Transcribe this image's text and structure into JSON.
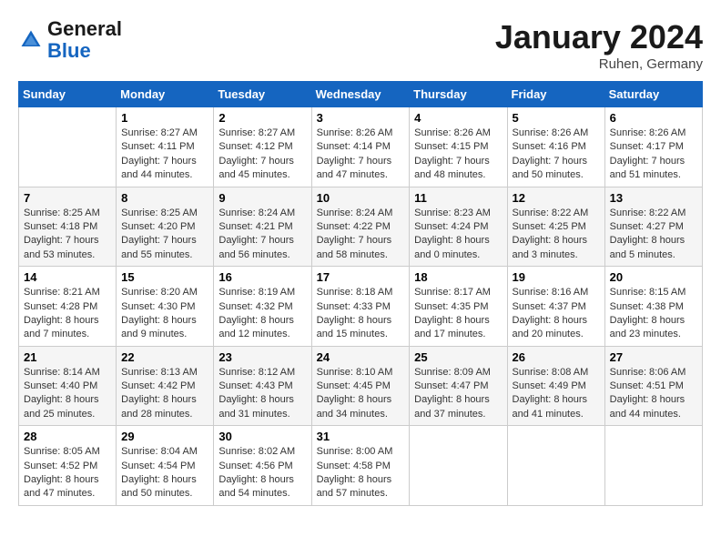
{
  "header": {
    "logo_line1": "General",
    "logo_line2": "Blue",
    "month": "January 2024",
    "location": "Ruhen, Germany"
  },
  "days_of_week": [
    "Sunday",
    "Monday",
    "Tuesday",
    "Wednesday",
    "Thursday",
    "Friday",
    "Saturday"
  ],
  "weeks": [
    [
      {
        "day": "",
        "sunrise": "",
        "sunset": "",
        "daylight": ""
      },
      {
        "day": "1",
        "sunrise": "Sunrise: 8:27 AM",
        "sunset": "Sunset: 4:11 PM",
        "daylight": "Daylight: 7 hours and 44 minutes."
      },
      {
        "day": "2",
        "sunrise": "Sunrise: 8:27 AM",
        "sunset": "Sunset: 4:12 PM",
        "daylight": "Daylight: 7 hours and 45 minutes."
      },
      {
        "day": "3",
        "sunrise": "Sunrise: 8:26 AM",
        "sunset": "Sunset: 4:14 PM",
        "daylight": "Daylight: 7 hours and 47 minutes."
      },
      {
        "day": "4",
        "sunrise": "Sunrise: 8:26 AM",
        "sunset": "Sunset: 4:15 PM",
        "daylight": "Daylight: 7 hours and 48 minutes."
      },
      {
        "day": "5",
        "sunrise": "Sunrise: 8:26 AM",
        "sunset": "Sunset: 4:16 PM",
        "daylight": "Daylight: 7 hours and 50 minutes."
      },
      {
        "day": "6",
        "sunrise": "Sunrise: 8:26 AM",
        "sunset": "Sunset: 4:17 PM",
        "daylight": "Daylight: 7 hours and 51 minutes."
      }
    ],
    [
      {
        "day": "7",
        "sunrise": "Sunrise: 8:25 AM",
        "sunset": "Sunset: 4:18 PM",
        "daylight": "Daylight: 7 hours and 53 minutes."
      },
      {
        "day": "8",
        "sunrise": "Sunrise: 8:25 AM",
        "sunset": "Sunset: 4:20 PM",
        "daylight": "Daylight: 7 hours and 55 minutes."
      },
      {
        "day": "9",
        "sunrise": "Sunrise: 8:24 AM",
        "sunset": "Sunset: 4:21 PM",
        "daylight": "Daylight: 7 hours and 56 minutes."
      },
      {
        "day": "10",
        "sunrise": "Sunrise: 8:24 AM",
        "sunset": "Sunset: 4:22 PM",
        "daylight": "Daylight: 7 hours and 58 minutes."
      },
      {
        "day": "11",
        "sunrise": "Sunrise: 8:23 AM",
        "sunset": "Sunset: 4:24 PM",
        "daylight": "Daylight: 8 hours and 0 minutes."
      },
      {
        "day": "12",
        "sunrise": "Sunrise: 8:22 AM",
        "sunset": "Sunset: 4:25 PM",
        "daylight": "Daylight: 8 hours and 3 minutes."
      },
      {
        "day": "13",
        "sunrise": "Sunrise: 8:22 AM",
        "sunset": "Sunset: 4:27 PM",
        "daylight": "Daylight: 8 hours and 5 minutes."
      }
    ],
    [
      {
        "day": "14",
        "sunrise": "Sunrise: 8:21 AM",
        "sunset": "Sunset: 4:28 PM",
        "daylight": "Daylight: 8 hours and 7 minutes."
      },
      {
        "day": "15",
        "sunrise": "Sunrise: 8:20 AM",
        "sunset": "Sunset: 4:30 PM",
        "daylight": "Daylight: 8 hours and 9 minutes."
      },
      {
        "day": "16",
        "sunrise": "Sunrise: 8:19 AM",
        "sunset": "Sunset: 4:32 PM",
        "daylight": "Daylight: 8 hours and 12 minutes."
      },
      {
        "day": "17",
        "sunrise": "Sunrise: 8:18 AM",
        "sunset": "Sunset: 4:33 PM",
        "daylight": "Daylight: 8 hours and 15 minutes."
      },
      {
        "day": "18",
        "sunrise": "Sunrise: 8:17 AM",
        "sunset": "Sunset: 4:35 PM",
        "daylight": "Daylight: 8 hours and 17 minutes."
      },
      {
        "day": "19",
        "sunrise": "Sunrise: 8:16 AM",
        "sunset": "Sunset: 4:37 PM",
        "daylight": "Daylight: 8 hours and 20 minutes."
      },
      {
        "day": "20",
        "sunrise": "Sunrise: 8:15 AM",
        "sunset": "Sunset: 4:38 PM",
        "daylight": "Daylight: 8 hours and 23 minutes."
      }
    ],
    [
      {
        "day": "21",
        "sunrise": "Sunrise: 8:14 AM",
        "sunset": "Sunset: 4:40 PM",
        "daylight": "Daylight: 8 hours and 25 minutes."
      },
      {
        "day": "22",
        "sunrise": "Sunrise: 8:13 AM",
        "sunset": "Sunset: 4:42 PM",
        "daylight": "Daylight: 8 hours and 28 minutes."
      },
      {
        "day": "23",
        "sunrise": "Sunrise: 8:12 AM",
        "sunset": "Sunset: 4:43 PM",
        "daylight": "Daylight: 8 hours and 31 minutes."
      },
      {
        "day": "24",
        "sunrise": "Sunrise: 8:10 AM",
        "sunset": "Sunset: 4:45 PM",
        "daylight": "Daylight: 8 hours and 34 minutes."
      },
      {
        "day": "25",
        "sunrise": "Sunrise: 8:09 AM",
        "sunset": "Sunset: 4:47 PM",
        "daylight": "Daylight: 8 hours and 37 minutes."
      },
      {
        "day": "26",
        "sunrise": "Sunrise: 8:08 AM",
        "sunset": "Sunset: 4:49 PM",
        "daylight": "Daylight: 8 hours and 41 minutes."
      },
      {
        "day": "27",
        "sunrise": "Sunrise: 8:06 AM",
        "sunset": "Sunset: 4:51 PM",
        "daylight": "Daylight: 8 hours and 44 minutes."
      }
    ],
    [
      {
        "day": "28",
        "sunrise": "Sunrise: 8:05 AM",
        "sunset": "Sunset: 4:52 PM",
        "daylight": "Daylight: 8 hours and 47 minutes."
      },
      {
        "day": "29",
        "sunrise": "Sunrise: 8:04 AM",
        "sunset": "Sunset: 4:54 PM",
        "daylight": "Daylight: 8 hours and 50 minutes."
      },
      {
        "day": "30",
        "sunrise": "Sunrise: 8:02 AM",
        "sunset": "Sunset: 4:56 PM",
        "daylight": "Daylight: 8 hours and 54 minutes."
      },
      {
        "day": "31",
        "sunrise": "Sunrise: 8:00 AM",
        "sunset": "Sunset: 4:58 PM",
        "daylight": "Daylight: 8 hours and 57 minutes."
      },
      {
        "day": "",
        "sunrise": "",
        "sunset": "",
        "daylight": ""
      },
      {
        "day": "",
        "sunrise": "",
        "sunset": "",
        "daylight": ""
      },
      {
        "day": "",
        "sunrise": "",
        "sunset": "",
        "daylight": ""
      }
    ]
  ]
}
